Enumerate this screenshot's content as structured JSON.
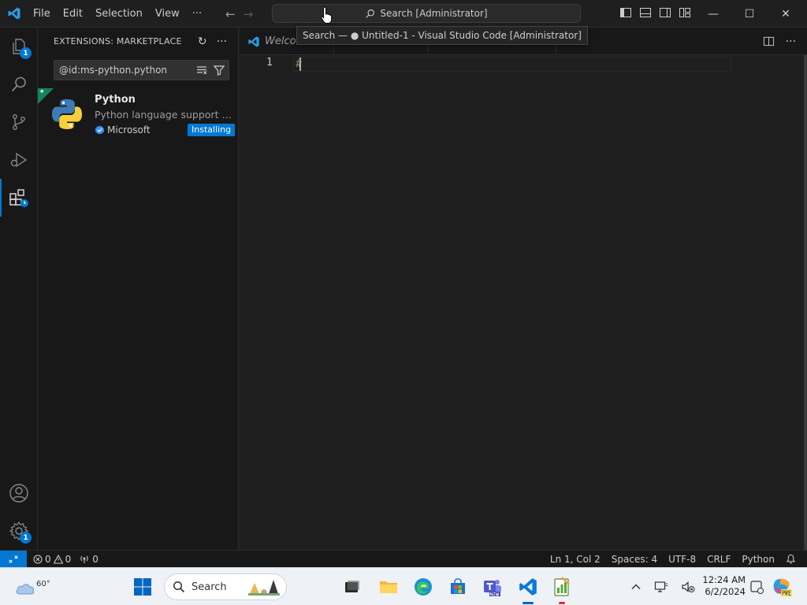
{
  "menu": [
    "File",
    "Edit",
    "Selection",
    "View",
    "···"
  ],
  "command_center": {
    "label": "Search [Administrator]"
  },
  "tooltip": {
    "text": "Search  — ● Untitled-1 - Visual Studio Code [Administrator]"
  },
  "window_controls": {
    "minimize": "—",
    "maximize": "☐",
    "close": "✕"
  },
  "activity_bar": {
    "explorer_badge": "1",
    "accounts_label": "Accounts",
    "manage_badge": "1"
  },
  "sidebar": {
    "title": "EXTENSIONS: MARKETPLACE",
    "search_value": "@id:ms-python.python",
    "extension": {
      "name": "Python",
      "description": "Python language support with extended features for Python",
      "publisher": "Microsoft",
      "status": "Installing"
    }
  },
  "editor": {
    "tabs": [
      {
        "label": "Welcome"
      }
    ],
    "line_number": "1",
    "code": "#"
  },
  "status_bar": {
    "errors": "0",
    "warnings": "0",
    "ports": "0",
    "position": "Ln 1, Col 2",
    "spaces": "Spaces: 4",
    "encoding": "UTF-8",
    "eol": "CRLF",
    "language": "Python"
  },
  "taskbar": {
    "weather_temp": "60°",
    "search_label": "Search",
    "time": "12:24 AM",
    "date": "6/2/2024"
  },
  "colors": {
    "accent": "#0078d4",
    "editor_bg": "#1f1f1f",
    "sidebar_bg": "#181818"
  }
}
